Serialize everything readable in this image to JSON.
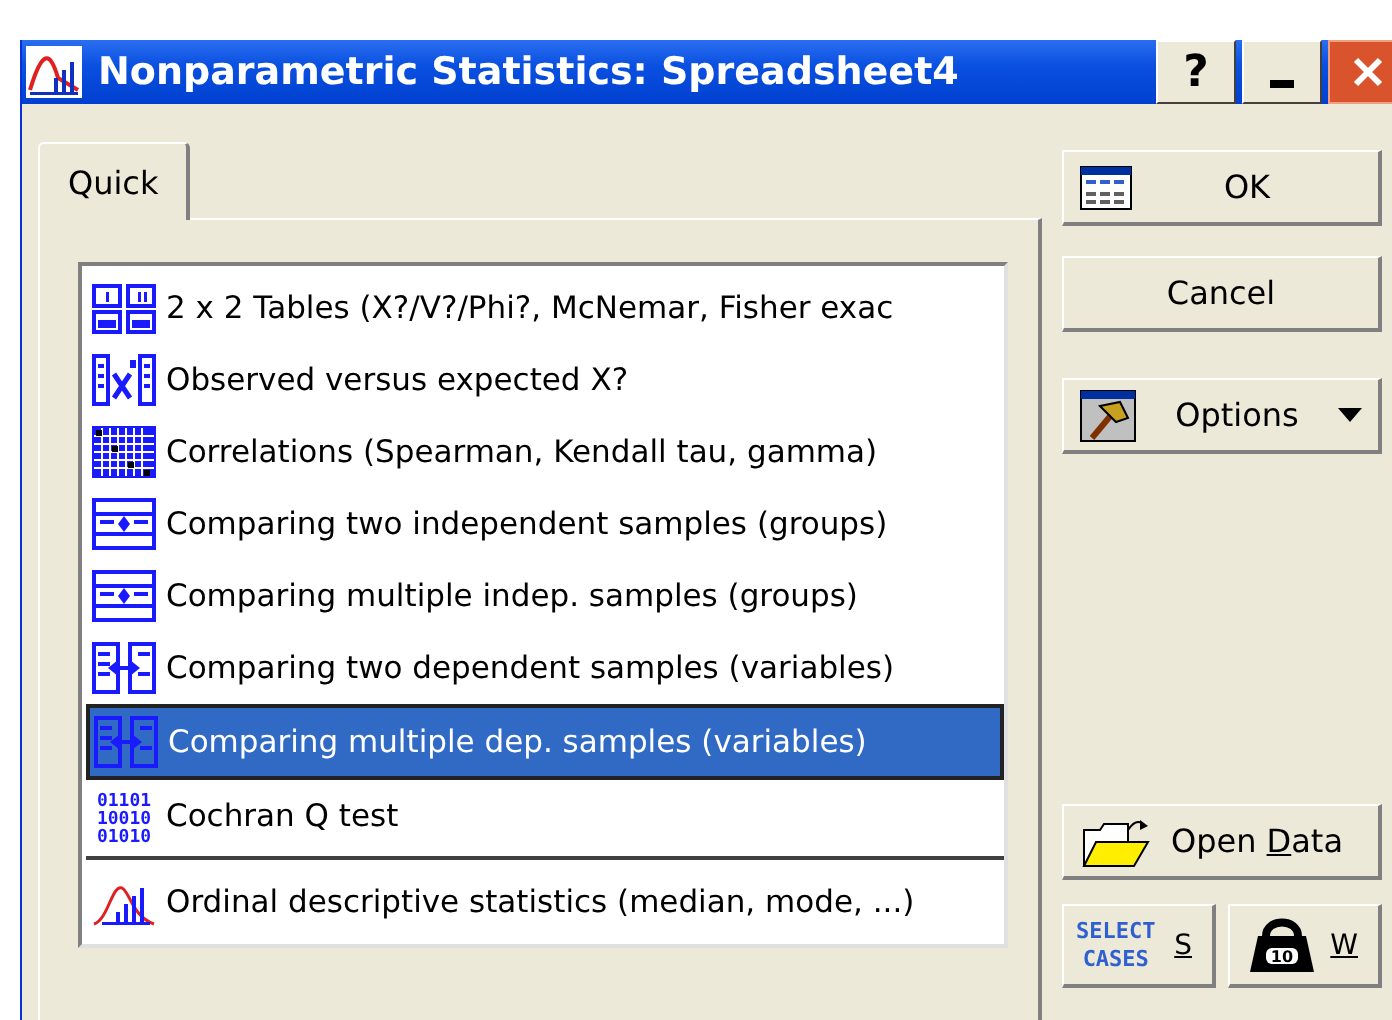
{
  "window": {
    "title": "Nonparametric Statistics: Spreadsheet4",
    "controls": [
      {
        "kind": "help",
        "label": "?"
      },
      {
        "kind": "minimize"
      },
      {
        "kind": "close"
      }
    ]
  },
  "tabs": [
    {
      "label": "Quick",
      "selected": true
    }
  ],
  "analyses": [
    {
      "kind": "tables",
      "label": "2 x 2 Tables (X?/V?/Phi?, McNemar, Fisher exac",
      "selected": false
    },
    {
      "kind": "chi",
      "label": "Observed versus expected X?",
      "selected": false
    },
    {
      "kind": "matrix",
      "label": "Correlations (Spearman, Kendall tau, gamma)",
      "selected": false
    },
    {
      "kind": "groups",
      "label": "Comparing two independent samples (groups)",
      "selected": false
    },
    {
      "kind": "groups",
      "label": "Comparing multiple indep. samples (groups)",
      "selected": false
    },
    {
      "kind": "variables",
      "label": "Comparing two dependent samples (variables)",
      "selected": false
    },
    {
      "kind": "variables",
      "label": "Comparing multiple dep. samples (variables)",
      "selected": true
    },
    {
      "kind": "binary",
      "label": "Cochran Q test",
      "selected": false,
      "icon_text": [
        "01101",
        "10010",
        "01010"
      ]
    },
    {
      "kind": "distribution",
      "label": "Ordinal descriptive statistics (median, mode, ...)",
      "selected": false,
      "separated": true
    }
  ],
  "buttons": [
    {
      "kind": "ok",
      "label": "OK"
    },
    {
      "kind": "cancel",
      "label": "Cancel"
    },
    {
      "kind": "options",
      "label": "Options"
    },
    {
      "kind": "open",
      "label_before": "Open ",
      "access_key": "D",
      "label_after": "ata"
    }
  ],
  "small_buttons": [
    {
      "kind": "select",
      "icon_text": [
        "SELECT",
        "CASES"
      ],
      "access_key": "S"
    },
    {
      "kind": "weight",
      "icon_text": "10",
      "access_key": "W"
    }
  ]
}
